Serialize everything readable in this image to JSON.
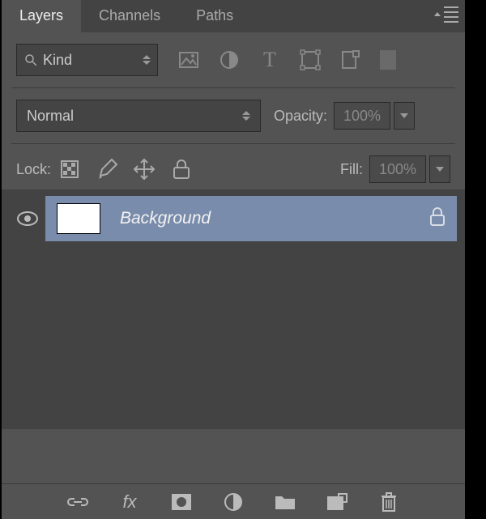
{
  "tabs": {
    "layers": "Layers",
    "channels": "Channels",
    "paths": "Paths",
    "active": 0
  },
  "filter": {
    "kind": "Kind"
  },
  "blend": {
    "mode": "Normal",
    "opacityLabel": "Opacity:",
    "opacityValue": "100%"
  },
  "lock": {
    "label": "Lock:",
    "fillLabel": "Fill:",
    "fillValue": "100%"
  },
  "layer": {
    "name": "Background"
  }
}
